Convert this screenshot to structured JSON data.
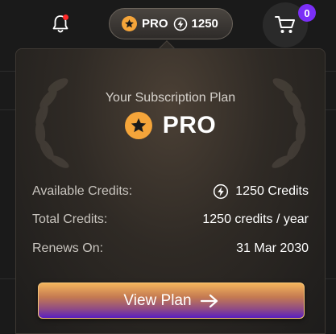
{
  "header": {
    "plan_badge_label": "PRO",
    "credits_count": "1250",
    "cart_count": "0"
  },
  "dropdown": {
    "heading": "Your Subscription Plan",
    "plan_name": "PRO",
    "details": [
      {
        "label": "Available Credits:",
        "value": "1250 Credits",
        "icon": "bolt-icon"
      },
      {
        "label": "Total Credits:",
        "value": "1250 credits / year"
      },
      {
        "label": "Renews On:",
        "value": "31 Mar 2030"
      }
    ],
    "view_plan_label": "View Plan"
  },
  "colors": {
    "accent_orange": "#f5a53a",
    "notification_dot": "#ff2a2a",
    "cart_badge": "#7b2ff7",
    "button_top": "#f3b45c",
    "button_bottom": "#5a1fc0"
  }
}
